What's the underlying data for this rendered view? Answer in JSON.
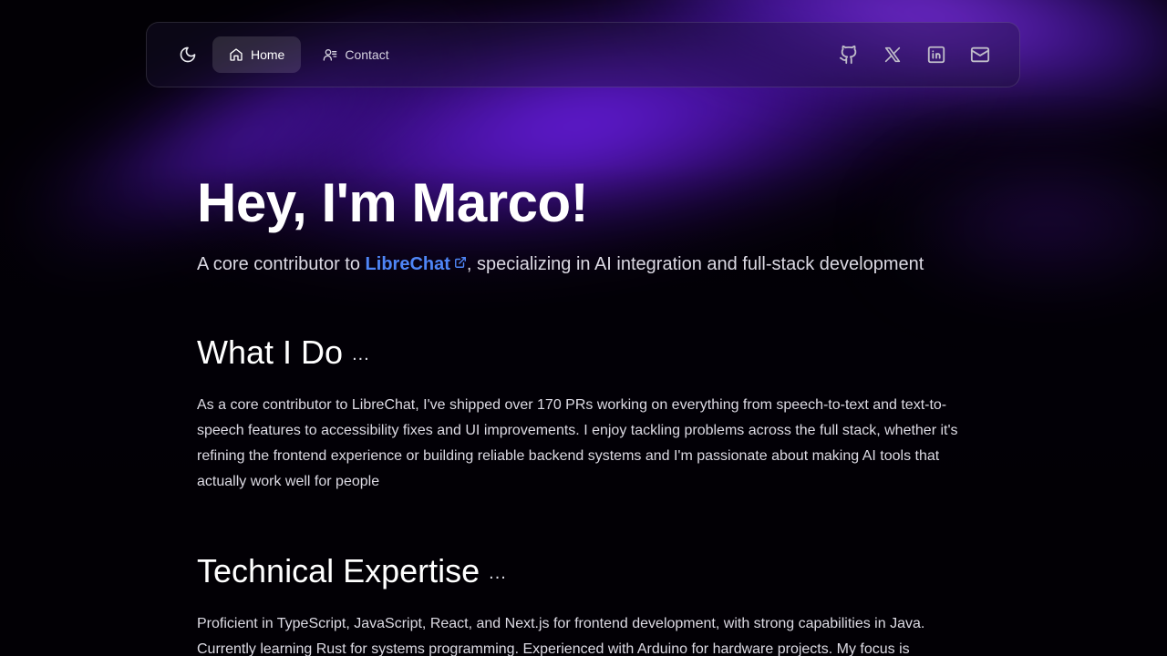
{
  "nav": {
    "theme_toggle_icon": "moon-icon",
    "links": [
      {
        "label": "Home",
        "icon": "home-icon",
        "active": true
      },
      {
        "label": "Contact",
        "icon": "contact-icon",
        "active": false
      }
    ],
    "socials": [
      {
        "name": "github-icon"
      },
      {
        "name": "x-icon"
      },
      {
        "name": "linkedin-icon"
      },
      {
        "name": "mail-icon"
      }
    ]
  },
  "hero": {
    "title": "Hey, I'm Marco!",
    "subtitle_prefix": "A core contributor to ",
    "link_text": "LibreChat",
    "subtitle_suffix": ", specializing in AI integration and full-stack development"
  },
  "sections": [
    {
      "title": "What I Do",
      "dots": "...",
      "body": "As a core contributor to LibreChat, I've shipped over 170 PRs working on everything from speech-to-text and text-to-speech features to accessibility fixes and UI improvements. I enjoy tackling problems across the full stack, whether it's refining the frontend experience or building reliable backend systems and I'm passionate about making AI tools that actually work well for people"
    },
    {
      "title": "Technical Expertise",
      "dots": "...",
      "body": "Proficient in TypeScript, JavaScript, React, and Next.js for frontend development, with strong capabilities in Java. Currently learning Rust for systems programming. Experienced with Arduino for hardware projects. My focus is"
    }
  ],
  "colors": {
    "accent_link": "#4f86f7",
    "glow_purple": "#7823ff",
    "background": "#020005"
  }
}
